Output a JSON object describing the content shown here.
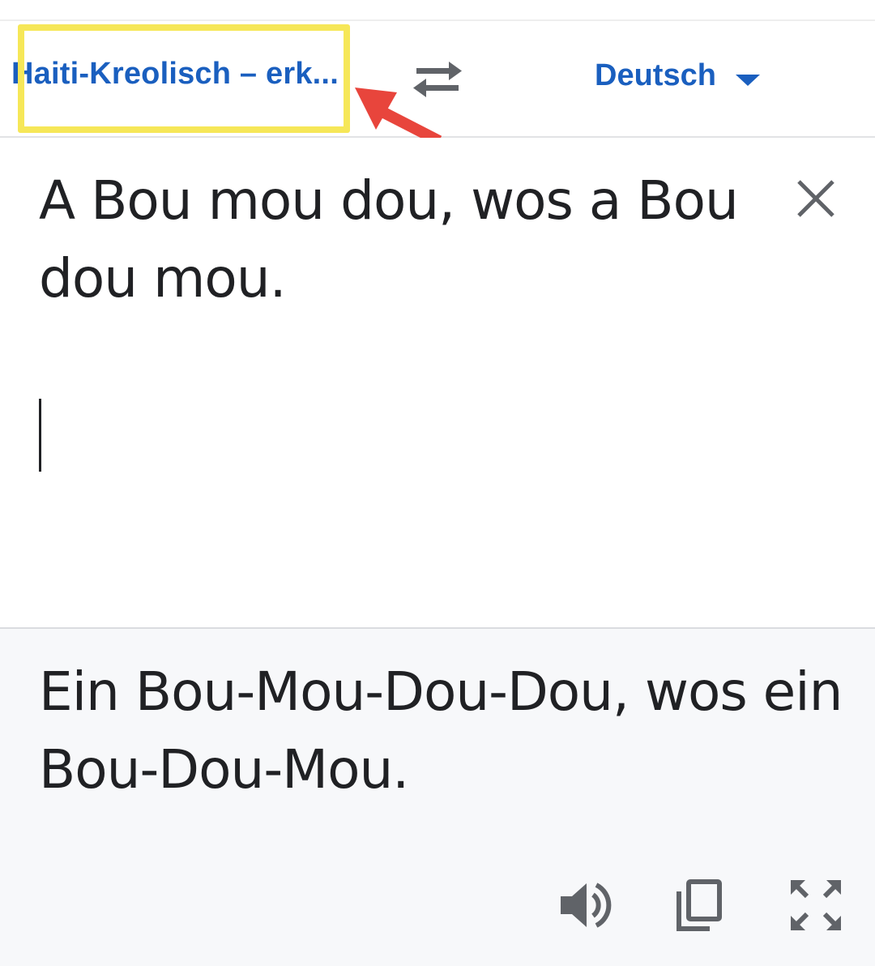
{
  "language_bar": {
    "source_language": "Haiti-Kreolisch – erk...",
    "target_language": "Deutsch",
    "swap_icon": "swap-arrows-icon",
    "dropdown_icon": "caret-down-icon"
  },
  "input": {
    "text": "A Bou mou dou, wos a Bou dou mou.",
    "clear_icon": "close-icon"
  },
  "output": {
    "text": "Ein Bou-Mou-Dou-Dou, wos ein Bou-Dou-Mou.",
    "actions": [
      "speaker-icon",
      "copy-icon",
      "fullscreen-icon"
    ]
  },
  "annotation": {
    "highlight_color": "#f6e758",
    "arrow_color": "#e8453c"
  },
  "colors": {
    "accent": "#1a5fbf",
    "text": "#202124",
    "icon": "#606368",
    "output_bg": "#f7f8fa"
  }
}
